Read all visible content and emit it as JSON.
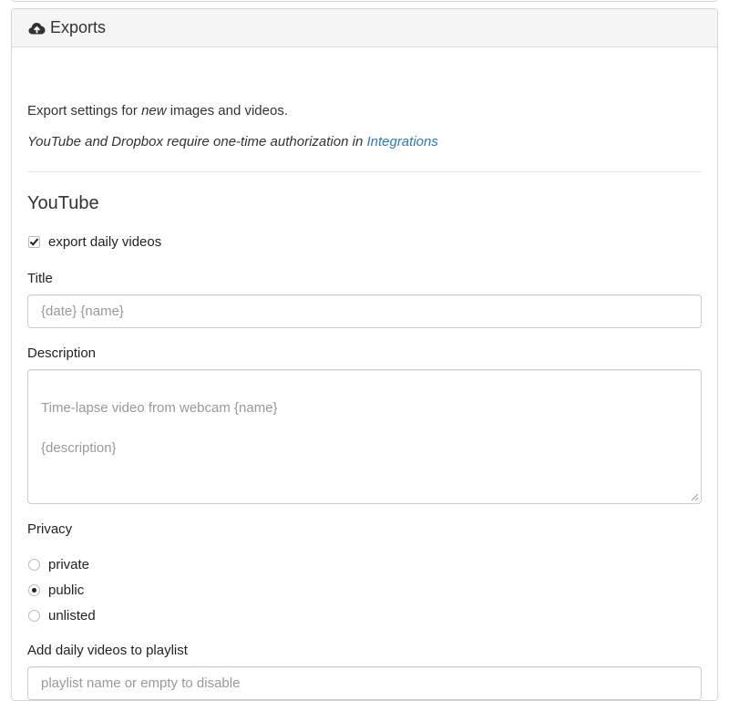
{
  "panel": {
    "heading": "Exports",
    "heading_icon": "cloud-upload-icon"
  },
  "intro": {
    "line1_prefix": "Export settings for ",
    "line1_emphasis": "new",
    "line1_suffix": " images and videos.",
    "line2_text": "YouTube and Dropbox require one-time authorization in ",
    "line2_link": "Integrations"
  },
  "youtube": {
    "section_title": "YouTube",
    "export_daily_label": "export daily videos",
    "export_daily_checked": true,
    "title_label": "Title",
    "title_placeholder": "{date} {name}",
    "description_label": "Description",
    "description_placeholder": "Time-lapse video from webcam {name}\n\n{description}",
    "privacy_label": "Privacy",
    "privacy_options": [
      {
        "label": "private",
        "checked": false
      },
      {
        "label": "public",
        "checked": true
      },
      {
        "label": "unlisted",
        "checked": false
      }
    ],
    "playlist_label": "Add daily videos to playlist",
    "playlist_placeholder": "playlist name or empty to disable"
  },
  "colors": {
    "link": "#2a7ab8",
    "heading_bg": "#f5f5f5",
    "border": "#d6d6d6"
  }
}
